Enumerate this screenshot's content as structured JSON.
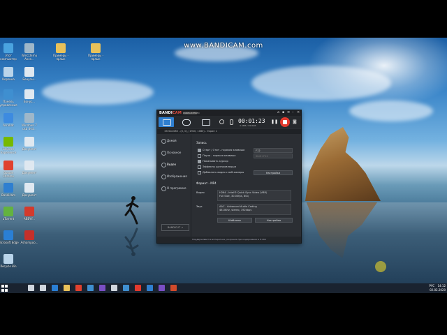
{
  "watermark": "www.BANDICAM.com",
  "desktop_icons": [
    {
      "label": "Этот компьютер",
      "icon": "computer-icon",
      "color": "#4aa3df"
    },
    {
      "label": "WinCDEmu Аксе...",
      "icon": "disc-icon",
      "color": "#9fb7c9"
    },
    {
      "label": "Примеры - ярлык",
      "icon": "folder-icon",
      "color": "#e8c15a"
    },
    {
      "label": "Примеры - ярлык",
      "icon": "folder-icon",
      "color": "#e8c15a"
    },
    {
      "label": "Корзина",
      "icon": "recycle-bin-icon",
      "color": "#b9d4ea"
    },
    {
      "label": "Бонусы...",
      "icon": "document-icon",
      "color": "#dfe8f0"
    },
    {
      "label": "Панель управления",
      "icon": "control-panel-icon",
      "color": "#3f8fd0"
    },
    {
      "label": "Бонус...",
      "icon": "document-icon",
      "color": "#dfe8f0"
    },
    {
      "label": "Acrobat",
      "icon": "acrobat-icon",
      "color": "#3d8be0"
    },
    {
      "label": "Windows 7 usb dvd...",
      "icon": "usb-icon",
      "color": "#9fb7c9"
    },
    {
      "label": "GeForce Experience",
      "icon": "nvidia-icon",
      "color": "#76b900"
    },
    {
      "label": "Документ",
      "icon": "document-icon",
      "color": "#dfe8f0"
    },
    {
      "label": "Google Chrome",
      "icon": "chrome-icon",
      "color": "#e0412f"
    },
    {
      "label": "Документ",
      "icon": "document-icon",
      "color": "#dfe8f0"
    },
    {
      "label": "Bandicam",
      "icon": "bandicam-icon",
      "color": "#2f7fd0"
    },
    {
      "label": "Документ",
      "icon": "document-icon",
      "color": "#dfe8f0"
    },
    {
      "label": "uTorrent",
      "icon": "utorrent-icon",
      "color": "#63b33f"
    },
    {
      "label": "ABBYY...",
      "icon": "abbyy-icon",
      "color": "#d33a2c"
    },
    {
      "label": "Microsoft Edge",
      "icon": "edge-icon",
      "color": "#2a7fd4"
    },
    {
      "label": "Ashampoo...",
      "icon": "burn-icon",
      "color": "#c4302b"
    },
    {
      "label": "Recycle Bin",
      "icon": "recycle-bin-icon",
      "color": "#b9d4ea"
    }
  ],
  "taskbar": {
    "apps": [
      {
        "icon": "search-icon",
        "color": "#d0d6de"
      },
      {
        "icon": "task-view-icon",
        "color": "#d0d6de"
      },
      {
        "icon": "edge-icon",
        "color": "#2a7fd4"
      },
      {
        "icon": "explorer-icon",
        "color": "#e8c15a"
      },
      {
        "icon": "chrome-icon",
        "color": "#e0412f"
      },
      {
        "icon": "store-icon",
        "color": "#3f8fd0"
      },
      {
        "icon": "visual-studio-icon",
        "color": "#7a4fc4"
      },
      {
        "icon": "calculator-icon",
        "color": "#d0d6de"
      },
      {
        "icon": "media-icon",
        "color": "#3f8fd0"
      },
      {
        "icon": "bandicam-icon",
        "color": "#e23a2e"
      },
      {
        "icon": "vs-code-icon",
        "color": "#2f7fd0"
      },
      {
        "icon": "app-icon",
        "color": "#7a4fc4"
      },
      {
        "icon": "presentation-icon",
        "color": "#d04a2b"
      }
    ],
    "lang": "РУС",
    "time": "14:12",
    "date": "02.02.2020"
  },
  "bandicam": {
    "logo_main": "BANDI",
    "logo_accent": "CAM",
    "logo_tag": "UNREGISTERED",
    "timer": "00:01:23",
    "file_size": "4.4MB / 99.8GB",
    "info_text": "1920x1080 - (0, 0), (1920, 1080) - Экран 1",
    "sidebar": [
      {
        "label": "Домой",
        "icon": "home-icon"
      },
      {
        "label": "Основное",
        "icon": "gear-icon"
      },
      {
        "label": "Видео",
        "icon": "video-icon"
      },
      {
        "label": "Изображения",
        "icon": "image-icon"
      },
      {
        "label": "О программе",
        "icon": "info-icon"
      }
    ],
    "bandicut_label": "BANDICUT ↗",
    "record_section": "Запись",
    "hotkey_value": "F12",
    "hotkey_secondary": "Shift+F12",
    "checks": [
      {
        "label": "Старт / Стоп - горячая клавиша",
        "checked": true
      },
      {
        "label": "Пауза - горячая клавиша",
        "checked": false
      },
      {
        "label": "Показывать курсор",
        "checked": true
      },
      {
        "label": "Эффекты щелчков мыши",
        "checked": false
      },
      {
        "label": "Добавлять видео с веб-камеры",
        "checked": false
      }
    ],
    "settings_button": "Настройки",
    "format_section": "Формат - MP4",
    "video_label": "Видео",
    "video_line1": "H264 - Intel® Quick Sync Video (VBR)",
    "video_line2": "Full Size, 30.00fps, 80q",
    "audio_label": "Звук",
    "audio_line1": "AAC - Advanced Audio Coding",
    "audio_line2": "48.0KHz, stereo, 192kbps",
    "templates_button": "Шаблоны",
    "settings_button2": "Настройка",
    "status_text": "Поддерживается аппаратное ускорение при кодировании в H.264"
  }
}
